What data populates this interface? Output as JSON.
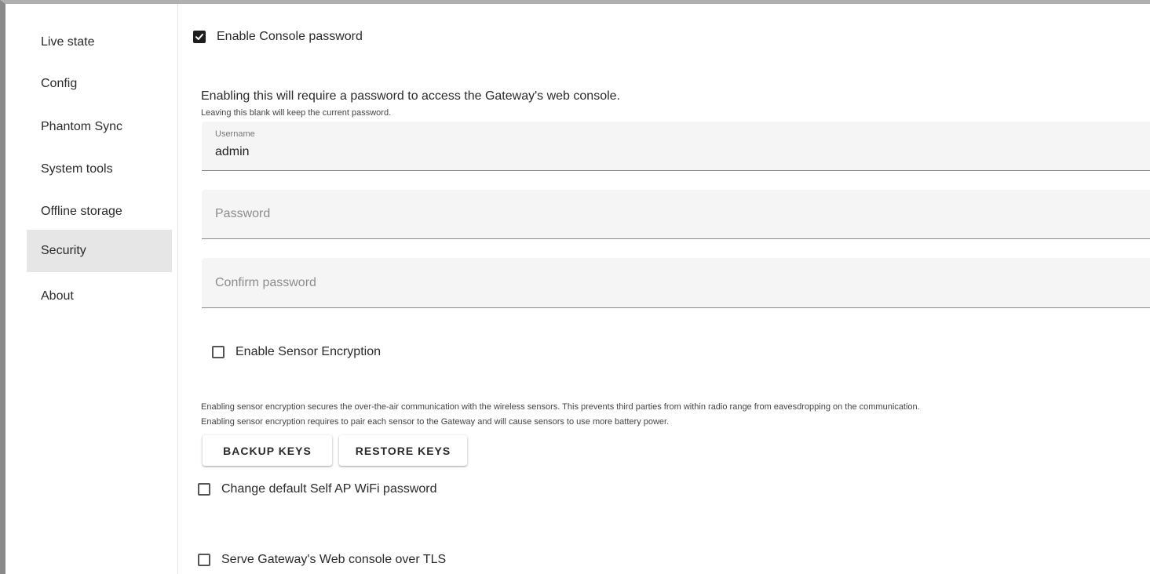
{
  "sidebar": {
    "items": [
      {
        "label": "Live state",
        "active": false
      },
      {
        "label": "Config",
        "active": false
      },
      {
        "label": "Phantom Sync",
        "active": false
      },
      {
        "label": "System tools",
        "active": false
      },
      {
        "label": "Offline storage",
        "active": false
      },
      {
        "label": "Security",
        "active": true
      },
      {
        "label": "About",
        "active": false
      }
    ]
  },
  "security": {
    "console_password": {
      "label": "Enable Console password",
      "checked": true,
      "description": "Enabling this will require a password to access the Gateway's web console.",
      "hint": "Leaving this blank will keep the current password."
    },
    "username": {
      "label": "Username",
      "value": "admin"
    },
    "password": {
      "placeholder": "Password"
    },
    "confirm_password": {
      "placeholder": "Confirm password"
    },
    "sensor_encryption": {
      "label": "Enable Sensor Encryption",
      "checked": false,
      "description_line1": "Enabling sensor encryption secures the over-the-air communication with the wireless sensors. This prevents third parties from within radio range from eavesdropping on the communication.",
      "description_line2": "Enabling sensor encryption requires to pair each sensor to the Gateway and will cause sensors to use more battery power.",
      "backup_label": "BACKUP KEYS",
      "restore_label": "RESTORE KEYS"
    },
    "self_ap": {
      "label": "Change default Self AP WiFi password",
      "checked": false
    },
    "tls": {
      "label": "Serve Gateway's Web console over TLS",
      "checked": false
    }
  },
  "colors": {
    "active_nav_bg": "#e6e6e6",
    "field_bg": "#f5f5f5",
    "checkbox_checked": "#1e1e1e"
  }
}
